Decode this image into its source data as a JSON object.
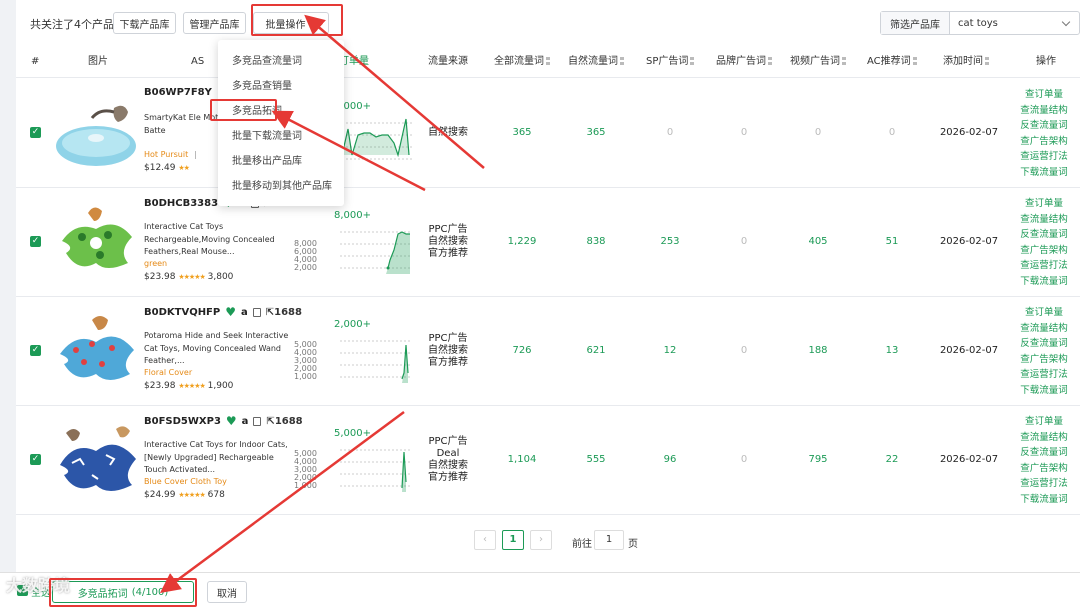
{
  "toolbar": {
    "followed_text": "共关注了4个产品",
    "download_label": "下载产品库",
    "manage_label": "管理产品库",
    "batch_label": "批量操作",
    "filter_label": "筛选产品库",
    "filter_value": "cat toys"
  },
  "columns": {
    "index": "#",
    "image": "图片",
    "asin": "AS",
    "monthly_orders": "月订单量",
    "traffic_source": "流量来源",
    "all_words": "全部流量词",
    "natural_words": "自然流量词",
    "sp_words": "SP广告词",
    "brand_words": "品牌广告词",
    "video_words": "视频广告词",
    "ac_words": "AC推荐词",
    "added_time": "添加时间",
    "actions": "操作"
  },
  "dropdown": {
    "items": [
      "多竞品查流量词",
      "多竞品查销量",
      "多竞品拓词",
      "批量下载流量词",
      "批量移出产品库",
      "批量移动到其他产品库"
    ]
  },
  "rows": [
    {
      "asin": "B06WP7F8Y",
      "title": "SmartyKat Ele Motion/Movin Kittens, Batte",
      "variant": "Hot Pursuit",
      "variant_sep": "|",
      "price": "$12.49",
      "reviews": "",
      "peak": "2,000+",
      "y_ticks": [],
      "traffic_source": [
        "自然搜索"
      ],
      "all_words": "365",
      "natural_words": "365",
      "sp_words": "0",
      "brand_words": "0",
      "video_words": "0",
      "ac_words": "0",
      "added_time": "2026-02-07"
    },
    {
      "asin": "B0DHCB3383",
      "title": "Interactive Cat Toys Rechargeable,Moving Concealed Feathers,Real Mouse...",
      "variant": "green",
      "variant_sep": "",
      "price": "$23.98",
      "reviews": "3,800",
      "peak": "8,000+",
      "y_ticks": [
        "8,000",
        "6,000",
        "4,000",
        "2,000"
      ],
      "traffic_source": [
        "PPC广告",
        "自然搜索",
        "官方推荐"
      ],
      "all_words": "1,229",
      "natural_words": "838",
      "sp_words": "253",
      "brand_words": "0",
      "video_words": "405",
      "ac_words": "51",
      "added_time": "2026-02-07"
    },
    {
      "asin": "B0DKTVQHFP",
      "title": "Potaroma Hide and Seek Interactive Cat Toys, Moving Concealed Wand Feather,...",
      "variant": "Floral Cover",
      "variant_sep": "",
      "price": "$23.98",
      "reviews": "1,900",
      "peak": "2,000+",
      "y_ticks": [
        "5,000",
        "4,000",
        "3,000",
        "2,000",
        "1,000"
      ],
      "traffic_source": [
        "PPC广告",
        "自然搜索",
        "官方推荐"
      ],
      "all_words": "726",
      "natural_words": "621",
      "sp_words": "12",
      "brand_words": "0",
      "video_words": "188",
      "ac_words": "13",
      "added_time": "2026-02-07"
    },
    {
      "asin": "B0FSD5WXP3",
      "title": "Interactive Cat Toys for Indoor Cats,[Newly Upgraded] Rechargeable Touch Activated...",
      "variant": "Blue Cover Cloth Toy",
      "variant_sep": "",
      "price": "$24.99",
      "reviews": "678",
      "peak": "5,000+",
      "y_ticks": [
        "5,000",
        "4,000",
        "3,000",
        "2,000",
        "1,000"
      ],
      "traffic_source": [
        "PPC广告",
        "Deal",
        "自然搜索",
        "官方推荐"
      ],
      "all_words": "1,104",
      "natural_words": "555",
      "sp_words": "96",
      "brand_words": "0",
      "video_words": "795",
      "ac_words": "22",
      "added_time": "2026-02-07"
    }
  ],
  "row_badge": "1688",
  "row_actions": [
    "查订单量",
    "查流量结构",
    "反查流量词",
    "查广告架构",
    "查运营打法",
    "下载流量词"
  ],
  "pagination": {
    "current": "1",
    "goto_label": "前往",
    "goto_value": "1",
    "page_suffix": "页"
  },
  "bottom": {
    "select_all": "全选",
    "compare_label": "多竞品拓词",
    "count": "(4/100)",
    "cancel_label": "取消"
  },
  "watermark": "大数跨境",
  "colors": {
    "accent": "#1c9a56",
    "annotation": "#e53935",
    "variant": "#e58a17"
  }
}
